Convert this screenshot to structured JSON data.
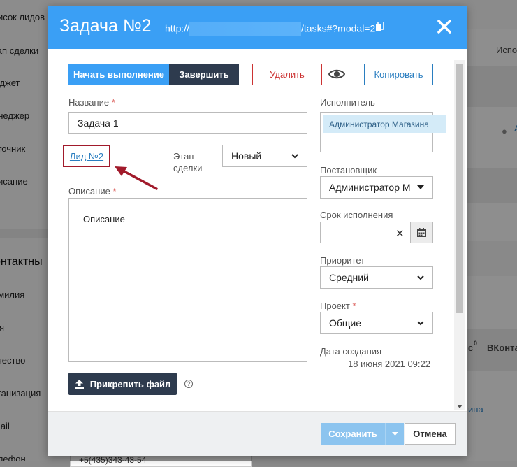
{
  "background": {
    "left_labels": [
      "писок лидов",
      "тап сделки",
      "юджет",
      "енеджер",
      "сточник",
      "писание"
    ],
    "left_section": "онтактны",
    "left_contact_labels": [
      "амилия",
      "мя",
      "тчество",
      "рганизация",
      "mail",
      "елефон"
    ],
    "right_labels": [
      "Испо",
      "Ал",
      "с",
      "0",
      "ВКонта",
      "ина"
    ],
    "bottom_phone": "+5(435)343-43-54"
  },
  "modal": {
    "title": "Задача №2",
    "url_prefix": "http://",
    "url_suffix": "/tasks#?modal=2",
    "actions": {
      "start": "Начать выполнение",
      "finish": "Завершить",
      "delete": "Удалить",
      "copy": "Копировать"
    },
    "name_field": {
      "label": "Название",
      "required": "*",
      "value": "Задача 1"
    },
    "lead_link": "Лид №2",
    "stage": {
      "label_line1": "Этап",
      "label_line2": "сделки",
      "selected": "Новый"
    },
    "description": {
      "label": "Описание",
      "required": "*",
      "value": "Описание"
    },
    "assignee": {
      "label": "Исполнитель",
      "chip": "Администратор Магазина"
    },
    "creator": {
      "label": "Постановщик",
      "selected": "Администратор М"
    },
    "deadline": {
      "label": "Срок исполнения",
      "value": "",
      "clear": "✕"
    },
    "priority": {
      "label": "Приоритет",
      "selected": "Средний"
    },
    "project": {
      "label": "Проект",
      "required": "*",
      "selected": "Общие"
    },
    "created": {
      "label": "Дата создания",
      "value": "18 июня 2021 09:22"
    },
    "attach_button": "Прикрепить файл",
    "help": "?",
    "footer": {
      "save": "Сохранить",
      "cancel": "Отмена"
    }
  },
  "colors": {
    "header": "#3a9ff5",
    "dark_button": "#2e3b4e",
    "danger": "#cc3333",
    "annotation_arrow": "#a11a2b"
  }
}
